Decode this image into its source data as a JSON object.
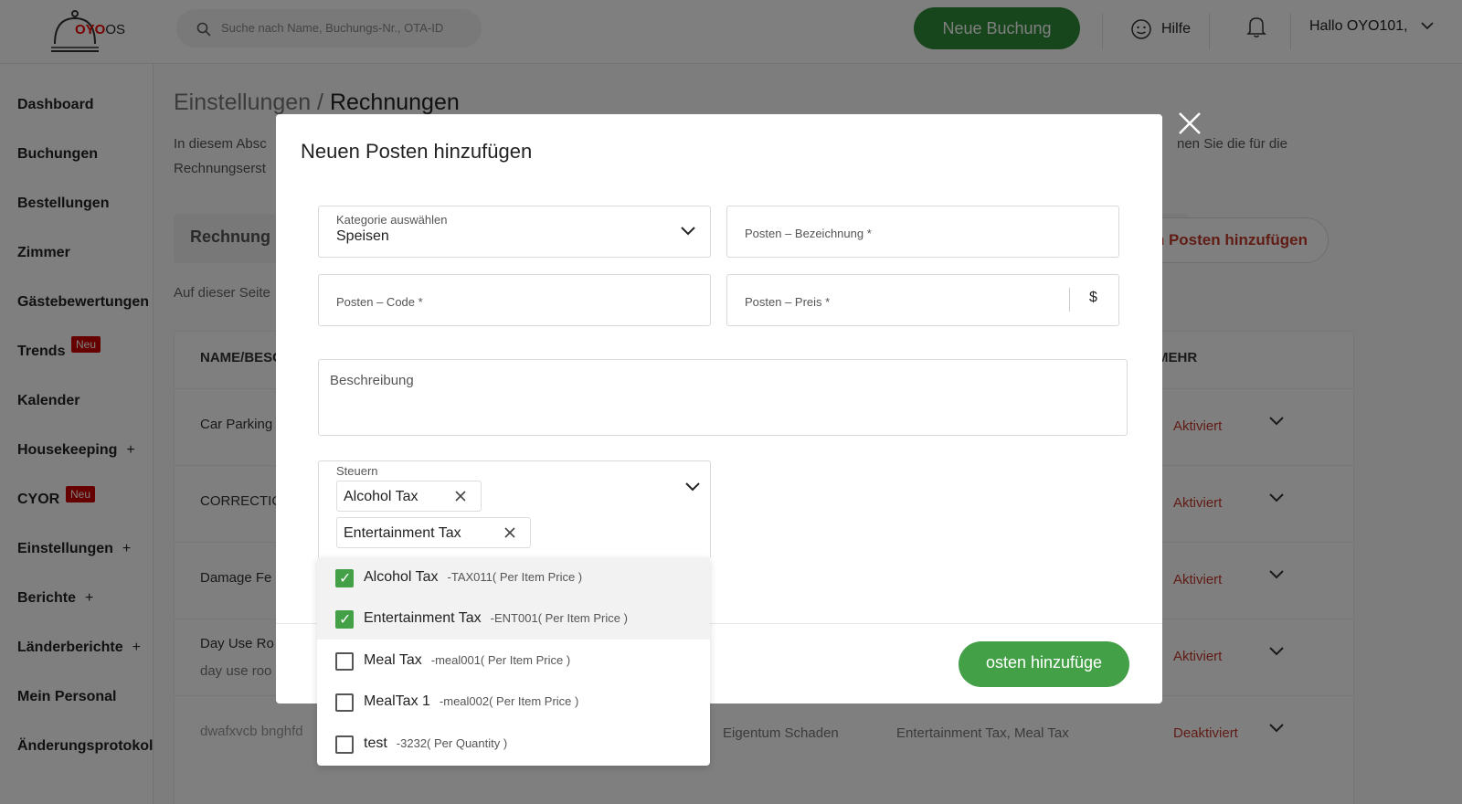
{
  "header": {
    "logo_main": "OYO",
    "logo_sub": "OS",
    "search_placeholder": "Suche nach Name, Buchungs-Nr., OTA-ID",
    "new_booking": "Neue Buchung",
    "help": "Hilfe",
    "greeting": "Hallo OYO101,"
  },
  "sidebar": {
    "items": [
      {
        "label": "Dashboard"
      },
      {
        "label": "Buchungen"
      },
      {
        "label": "Bestellungen"
      },
      {
        "label": "Zimmer"
      },
      {
        "label": "Gästebewertungen"
      },
      {
        "label": "Trends",
        "badge": "Neu"
      },
      {
        "label": "Kalender"
      },
      {
        "label": "Housekeeping",
        "expand": "+"
      },
      {
        "label": "CYOR",
        "badge": "Neu"
      },
      {
        "label": "Einstellungen",
        "expand": "+"
      },
      {
        "label": "Berichte",
        "expand": "+"
      },
      {
        "label": "Länderberichte",
        "expand": "+"
      },
      {
        "label": "Mein Personal"
      },
      {
        "label": "Änderungsprotokoll"
      }
    ]
  },
  "page": {
    "breadcrumb_parent": "Einstellungen /",
    "breadcrumb_current": "Rechnungen",
    "intro_left_1": "In diesem Absc",
    "intro_left_2": "Rechnungserst",
    "intro_right": "nen Sie die für die",
    "tab_label": "Rechnung",
    "add_item_button": "uen Posten hinzufügen",
    "subnote": "Auf dieser Seite",
    "table": {
      "col_name": "NAME/BESC",
      "col_more": "MEHR",
      "rows": [
        {
          "name": "Car Parking",
          "status": "Aktiviert"
        },
        {
          "name": "CORRECTIC",
          "status": "Aktiviert"
        },
        {
          "name": "Damage Fe",
          "status": "Aktiviert"
        },
        {
          "name": "Day Use Ro",
          "sub": "day use roo",
          "status": "Aktiviert"
        },
        {
          "name": "dwafxvcb bnghfd",
          "category": "Eigentum Schaden",
          "taxes": "Entertainment Tax, Meal Tax",
          "status": "Deaktiviert"
        }
      ]
    }
  },
  "modal": {
    "title": "Neuen Posten hinzufügen",
    "category_label": "Kategorie auswählen",
    "category_value": "Speisen",
    "item_name_placeholder": "Posten – Bezeichnung *",
    "item_code_placeholder": "Posten – Code *",
    "item_price_placeholder": "Posten – Preis *",
    "currency": "$",
    "description_placeholder": "Beschreibung",
    "taxes_label": "Steuern",
    "selected_taxes": [
      "Alcohol Tax",
      "Entertainment Tax"
    ],
    "submit": "osten hinzufüge",
    "tax_options": [
      {
        "name": "Alcohol Tax",
        "code": "-TAX011( Per Item Price )",
        "checked": true
      },
      {
        "name": "Entertainment Tax",
        "code": "-ENT001( Per Item Price )",
        "checked": true
      },
      {
        "name": "Meal Tax",
        "code": "-meal001( Per Item Price )",
        "checked": false
      },
      {
        "name": "MealTax 1",
        "code": "-meal002( Per Item Price )",
        "checked": false
      },
      {
        "name": "test",
        "code": "-3232( Per Quantity )",
        "checked": false
      }
    ]
  },
  "colors": {
    "brand_red": "#e00000",
    "primary_green": "#2f8c3a",
    "submit_green": "#43a047",
    "status_red": "#c0392b"
  },
  "icons": [
    "logo-bell-icon",
    "search-icon",
    "help-face-icon",
    "notification-bell-icon",
    "chevron-down-icon",
    "close-icon",
    "checkbox-icon"
  ]
}
